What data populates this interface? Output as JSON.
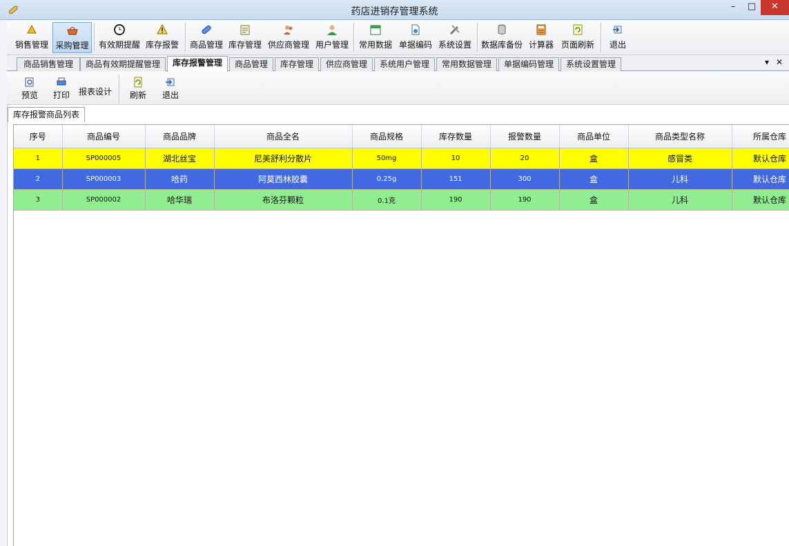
{
  "window": {
    "title": "药店进销存管理系统",
    "min": "–",
    "max": "□",
    "close": "✕"
  },
  "colors": {
    "row_alert": "#ffff00",
    "row_selected": "#4169e1",
    "row_normal": "#90ee90",
    "accent": "#7da2ce"
  },
  "toolbar": [
    {
      "label": "销售管理",
      "icon": "cone-icon"
    },
    {
      "label": "采购管理",
      "icon": "basket-icon",
      "active": true
    },
    {
      "label": "有效期提醒",
      "icon": "clock-icon"
    },
    {
      "label": "库存报警",
      "icon": "warning-icon"
    },
    {
      "label": "商品管理",
      "icon": "capsule-icon"
    },
    {
      "label": "库存管理",
      "icon": "clipboard-icon"
    },
    {
      "label": "供应商管理",
      "icon": "users-icon"
    },
    {
      "label": "用户管理",
      "icon": "user-icon"
    },
    {
      "label": "常用数据",
      "icon": "calendar-icon"
    },
    {
      "label": "单据编码",
      "icon": "document-icon"
    },
    {
      "label": "系统设置",
      "icon": "tools-icon"
    },
    {
      "label": "数据库备份",
      "icon": "database-icon"
    },
    {
      "label": "计算器",
      "icon": "calculator-icon"
    },
    {
      "label": "页面刷新",
      "icon": "refresh-icon"
    },
    {
      "label": "退出",
      "icon": "exit-icon"
    }
  ],
  "tabs": [
    {
      "label": "商品销售管理"
    },
    {
      "label": "商品有效期提醒管理"
    },
    {
      "label": "库存报警管理",
      "active": true
    },
    {
      "label": "商品管理"
    },
    {
      "label": "库存管理"
    },
    {
      "label": "供应商管理"
    },
    {
      "label": "系统用户管理"
    },
    {
      "label": "常用数据管理"
    },
    {
      "label": "单据编码管理"
    },
    {
      "label": "系统设置管理"
    }
  ],
  "tab_controls": {
    "dropdown": "▾",
    "close": "✕"
  },
  "subtoolbar": {
    "preview": "预览",
    "print": "打印",
    "report_design": "报表设计",
    "refresh": "刷新",
    "exit": "退出"
  },
  "panel": {
    "tab_label": "库存报警商品列表"
  },
  "table": {
    "columns": [
      "序号",
      "商品编号",
      "商品品牌",
      "商品全名",
      "商品规格",
      "库存数量",
      "报警数量",
      "商品单位",
      "商品类型名称",
      "所属仓库"
    ],
    "rows": [
      [
        "1",
        "SP000005",
        "湖北丝宝",
        "尼美舒利分散片",
        "50mg",
        "10",
        "20",
        "盒",
        "感冒类",
        "默认仓库"
      ],
      [
        "2",
        "SP000003",
        "哈药",
        "阿莫西林胶囊",
        "0.25g",
        "151",
        "300",
        "盒",
        "儿科",
        "默认仓库"
      ],
      [
        "3",
        "SP000002",
        "哈华瑞",
        "布洛芬颗粒",
        "0.1克",
        "190",
        "190",
        "盒",
        "儿科",
        "默认仓库"
      ]
    ]
  }
}
